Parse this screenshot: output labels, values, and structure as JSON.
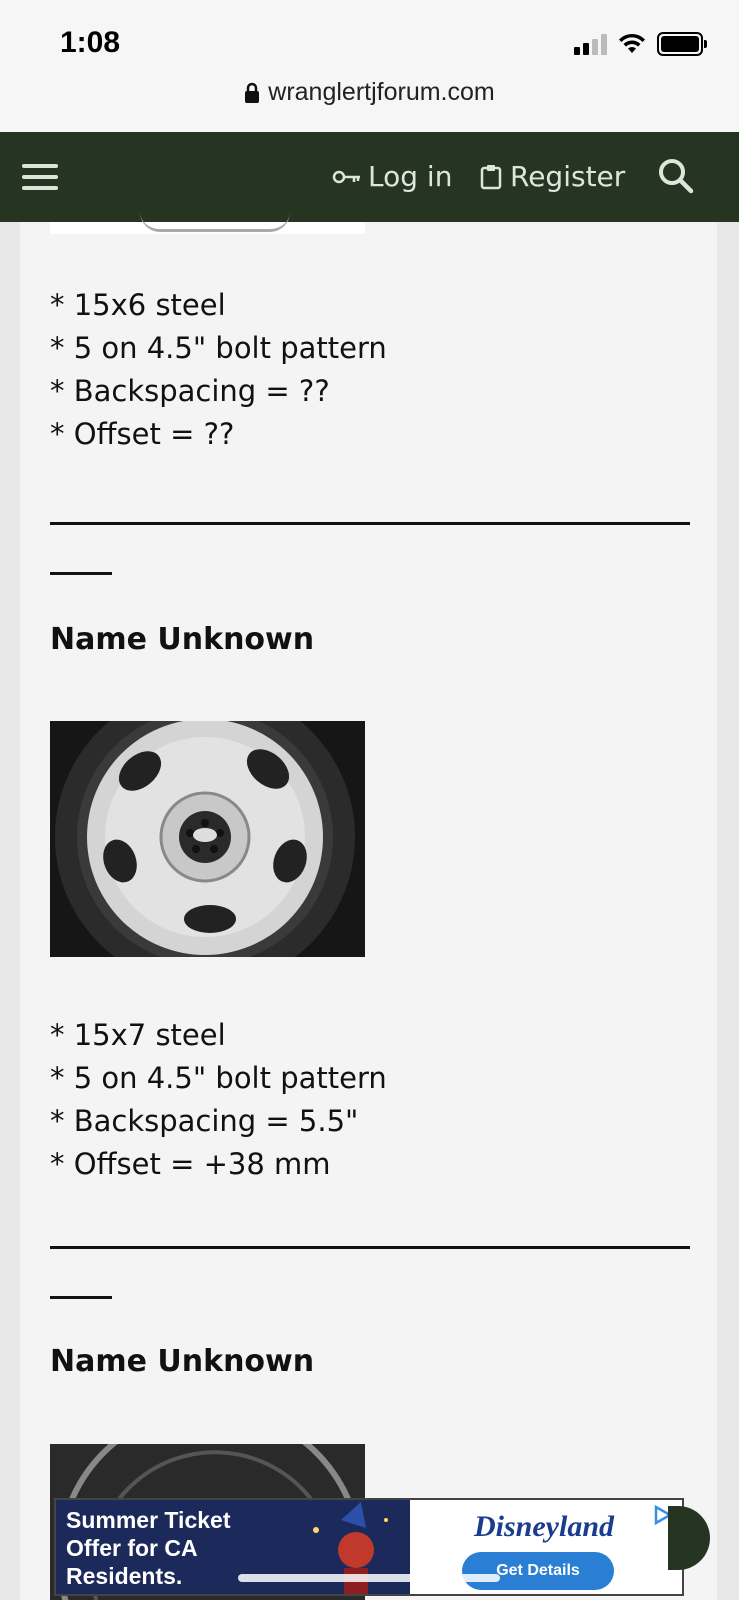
{
  "status_bar": {
    "time": "1:08"
  },
  "browser": {
    "url": "wranglertjforum.com"
  },
  "nav": {
    "login_label": "Log in",
    "register_label": "Register"
  },
  "post": {
    "wheel1_specs": [
      "* 15x6 steel",
      "* 5 on 4.5\" bolt pattern",
      "* Backspacing = ??",
      "* Offset = ??"
    ],
    "divider": "________________________________",
    "wheel2_name": "Name Unknown",
    "wheel2_specs": [
      "* 15x7 steel",
      "* 5 on 4.5\" bolt pattern",
      "* Backspacing = 5.5\"",
      "* Offset = +38 mm"
    ],
    "wheel3_name": "Name Unknown"
  },
  "ad": {
    "headline_lines": [
      "Summer Ticket",
      "Offer for CA",
      "Residents."
    ],
    "brand": "Disneyland",
    "cta": "Get Details"
  },
  "colors": {
    "nav_bg": "#253522",
    "nav_text": "#dfe5dc",
    "content_bg": "#f4f4f4"
  }
}
